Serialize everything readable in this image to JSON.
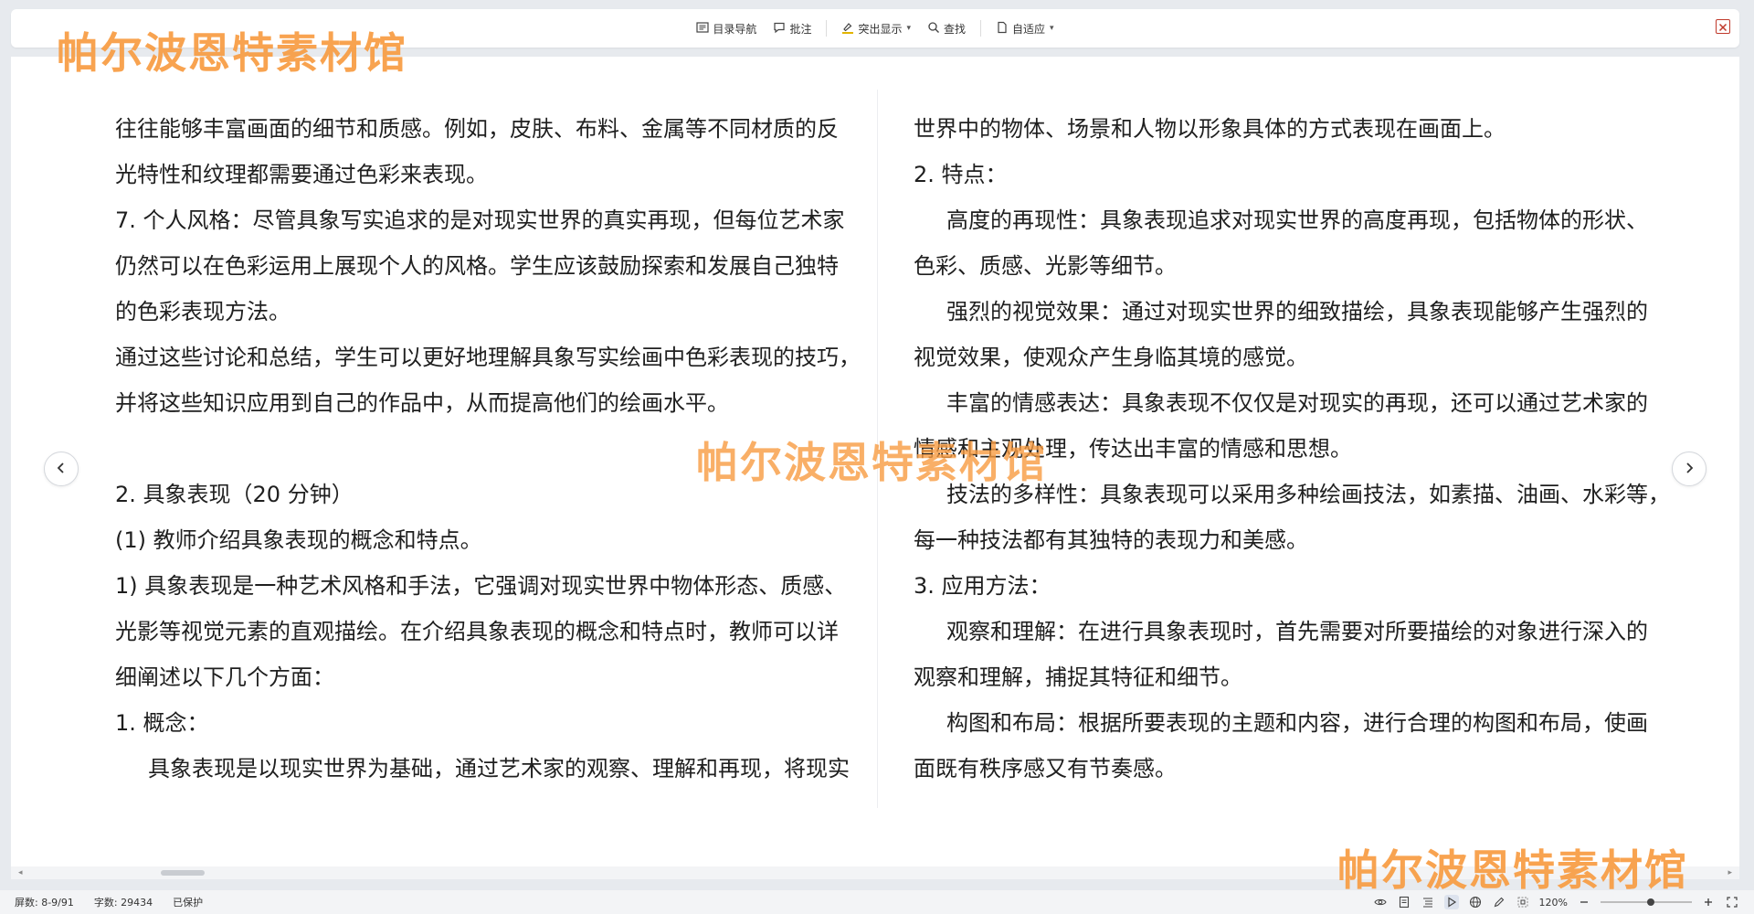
{
  "toolbar": {
    "toc_label": "目录导航",
    "comment_label": "批注",
    "highlight_label": "突出显示",
    "find_label": "查找",
    "fit_label": "自适应"
  },
  "watermark": "帕尔波恩特素材馆",
  "document": {
    "left_column": [
      {
        "text": "往往能够丰富画面的细节和质感。例如，皮肤、布料、金属等不同材质的反",
        "indent": false
      },
      {
        "text": "光特性和纹理都需要通过色彩来表现。",
        "indent": false
      },
      {
        "text": "7. 个人风格：尽管具象写实追求的是对现实世界的真实再现，但每位艺术家",
        "indent": false
      },
      {
        "text": "仍然可以在色彩运用上展现个人的风格。学生应该鼓励探索和发展自己独特",
        "indent": false
      },
      {
        "text": "的色彩表现方法。",
        "indent": false
      },
      {
        "text": "通过这些讨论和总结，学生可以更好地理解具象写实绘画中色彩表现的技巧，",
        "indent": false
      },
      {
        "text": "并将这些知识应用到自己的作品中，从而提高他们的绘画水平。",
        "indent": false
      },
      {
        "text": "",
        "indent": false
      },
      {
        "text": "2. 具象表现（20 分钟）",
        "indent": false
      },
      {
        "text": "(1) 教师介绍具象表现的概念和特点。",
        "indent": false
      },
      {
        "text": "1) 具象表现是一种艺术风格和手法，它强调对现实世界中物体形态、质感、",
        "indent": false
      },
      {
        "text": "光影等视觉元素的直观描绘。在介绍具象表现的概念和特点时，教师可以详",
        "indent": false
      },
      {
        "text": "细阐述以下几个方面：",
        "indent": false
      },
      {
        "text": "1. 概念：",
        "indent": false
      },
      {
        "text": "具象表现是以现实世界为基础，通过艺术家的观察、理解和再现，将现实",
        "indent": true
      }
    ],
    "right_column": [
      {
        "text": "世界中的物体、场景和人物以形象具体的方式表现在画面上。",
        "indent": false
      },
      {
        "text": "2. 特点：",
        "indent": false
      },
      {
        "text": "高度的再现性：具象表现追求对现实世界的高度再现，包括物体的形状、",
        "indent": true
      },
      {
        "text": "色彩、质感、光影等细节。",
        "indent": false
      },
      {
        "text": "强烈的视觉效果：通过对现实世界的细致描绘，具象表现能够产生强烈的",
        "indent": true
      },
      {
        "text": "视觉效果，使观众产生身临其境的感觉。",
        "indent": false
      },
      {
        "text": "丰富的情感表达：具象表现不仅仅是对现实的再现，还可以通过艺术家的",
        "indent": true
      },
      {
        "text": "情感和主观处理，传达出丰富的情感和思想。",
        "indent": false
      },
      {
        "text": "技法的多样性：具象表现可以采用多种绘画技法，如素描、油画、水彩等，",
        "indent": true
      },
      {
        "text": "每一种技法都有其独特的表现力和美感。",
        "indent": false
      },
      {
        "text": "3. 应用方法：",
        "indent": false
      },
      {
        "text": "观察和理解：在进行具象表现时，首先需要对所要描绘的对象进行深入的",
        "indent": true
      },
      {
        "text": "观察和理解，捕捉其特征和细节。",
        "indent": false
      },
      {
        "text": "构图和布局：根据所要表现的主题和内容，进行合理的构图和布局，使画",
        "indent": true
      },
      {
        "text": "面既有秩序感又有节奏感。",
        "indent": false
      }
    ]
  },
  "status": {
    "screen": "屏数: 8-9/91",
    "word_count": "字数: 29434",
    "protected": "已保护",
    "zoom": "120%",
    "zoom_level": 0.55
  },
  "colors": {
    "watermark": "#f79b41",
    "close_border": "#c0392b"
  }
}
